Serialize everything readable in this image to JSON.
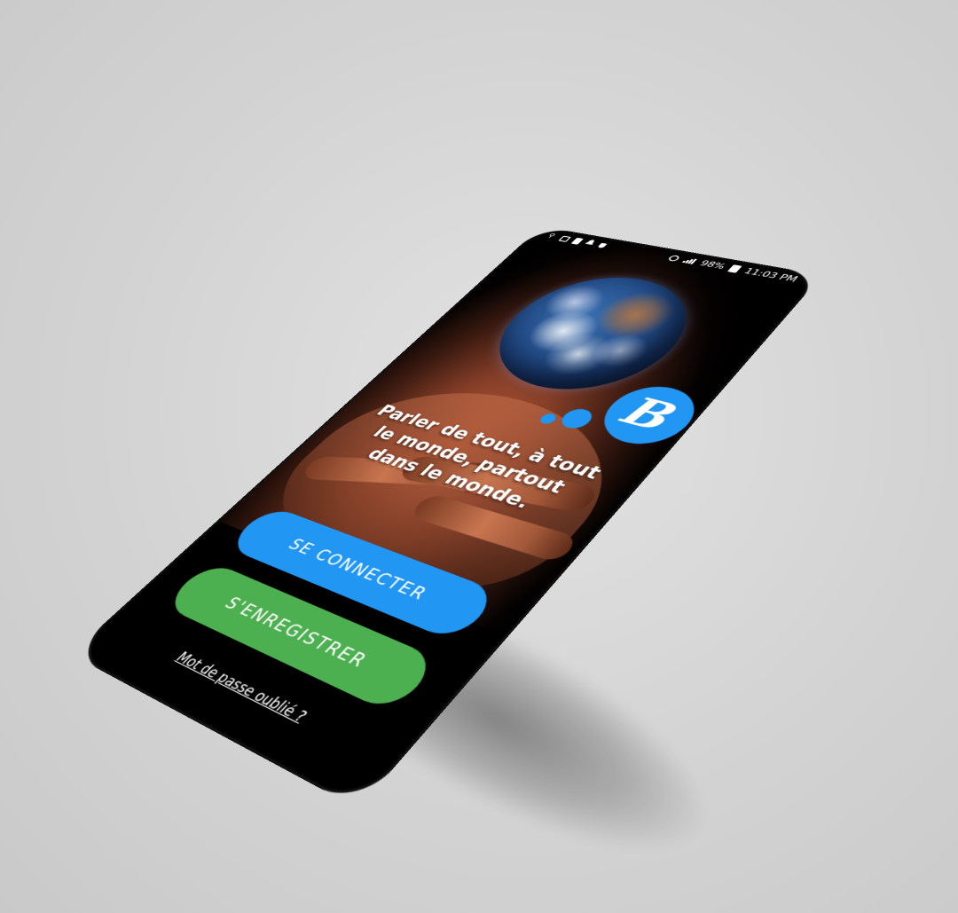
{
  "status_bar": {
    "battery_percent": "98%",
    "time": "11:03 PM",
    "left_icons": [
      "usb-icon",
      "image-icon",
      "battery-saver-icon",
      "bell-icon",
      "shield-icon"
    ],
    "right_icons": [
      "alarm-icon",
      "signal-icon",
      "battery-icon"
    ]
  },
  "app": {
    "logo_letter": "B",
    "tagline": "Parler de tout, à tout le monde, partout dans le monde."
  },
  "actions": {
    "login_label": "SE CONNECTER",
    "register_label": "S'ENREGISTRER",
    "forgot_password_label": "Mot de passe oublié ?"
  },
  "colors": {
    "primary_blue": "#2196f3",
    "register_green": "#4caf50",
    "background": "#000000"
  }
}
